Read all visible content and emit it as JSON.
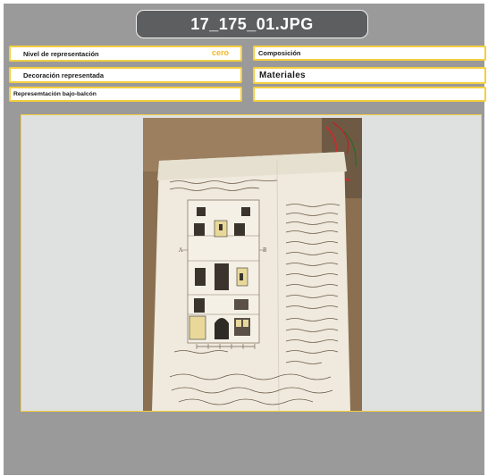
{
  "title": "17_175_01.JPG",
  "fields": {
    "nivel_label": "Nivel de representación",
    "nivel_value": "cero",
    "composicion_label": "Composición",
    "decoracion_label": "Decoración representada",
    "materiales_label": "Materiales",
    "representacion_label": "Represemtación bajo-balcón",
    "empty_value": ""
  },
  "colors": {
    "accent_yellow": "#f5cf3e",
    "value_orange": "#f5b820",
    "panel_gray": "#9a9a9b",
    "title_bg": "#5d5e5f"
  }
}
